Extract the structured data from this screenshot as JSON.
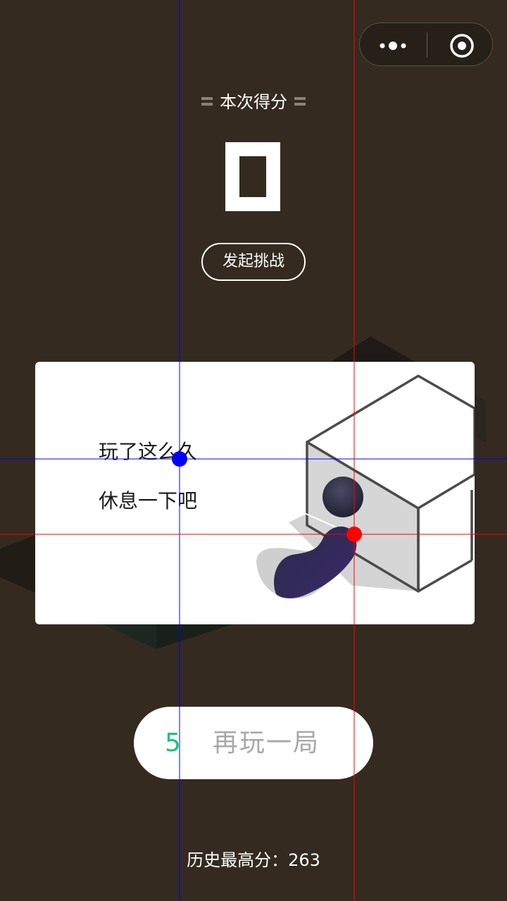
{
  "header": {
    "title": "本次得分",
    "score": "0",
    "challenge_label": "发起挑战"
  },
  "capsule": {
    "more_icon": "more-dots-icon",
    "close_icon": "target-circle-icon"
  },
  "card": {
    "line1": "玩了这么久",
    "line2": "休息一下吧"
  },
  "replay": {
    "countdown": "5",
    "label": "再玩一局"
  },
  "footer": {
    "best_label": "历史最高分：",
    "best_value": "263"
  },
  "colors": {
    "background": "#342a1f",
    "accent_green": "#13c57b",
    "replay_text": "#a8a8a8",
    "guide_blue": "#0000ff",
    "guide_red": "#ff0000"
  }
}
